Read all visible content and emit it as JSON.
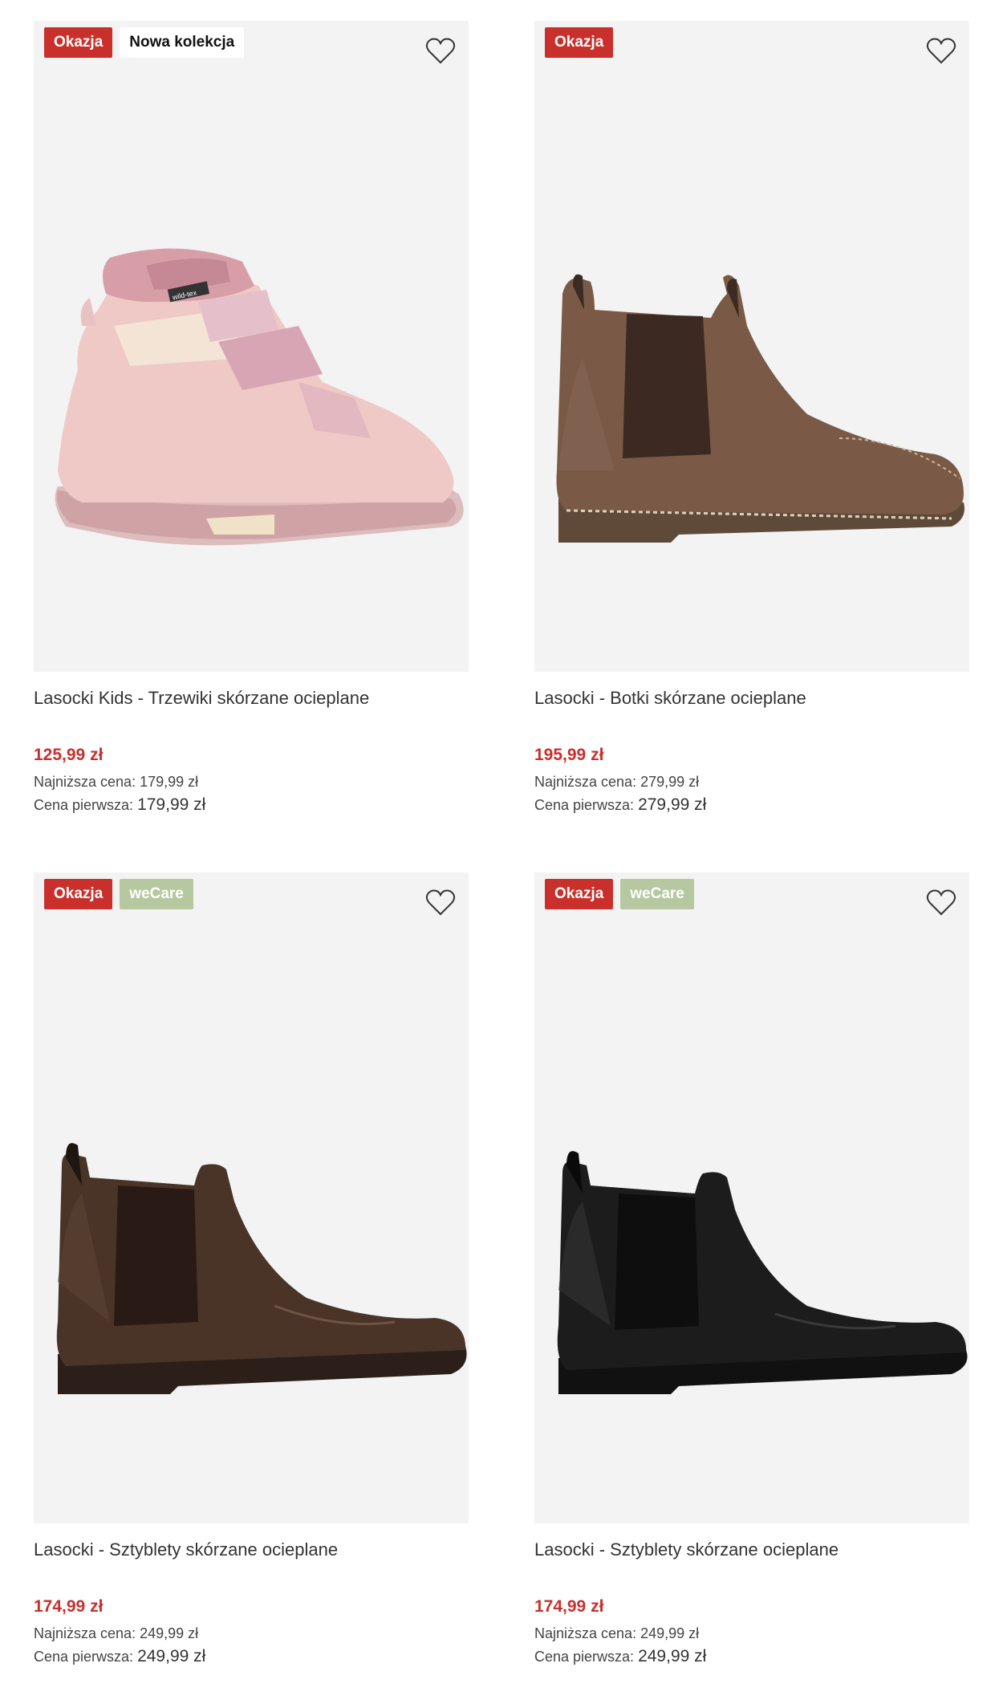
{
  "products": [
    {
      "badges": [
        "Okazja",
        "Nowa kolekcja"
      ],
      "title": "Lasocki Kids - Trzewiki skórzane ocieplane",
      "price": "125,99 zł",
      "lowest_label": "Najniższa cena:",
      "lowest_value": "179,99 zł",
      "first_label": "Cena pierwsza:",
      "first_value": "179,99 zł",
      "image": "pink-kids-velcro-boot",
      "brand_tag": "wild-tex"
    },
    {
      "badges": [
        "Okazja"
      ],
      "title": "Lasocki - Botki skórzane ocieplane",
      "price": "195,99 zł",
      "lowest_label": "Najniższa cena:",
      "lowest_value": "279,99 zł",
      "first_label": "Cena pierwsza:",
      "first_value": "279,99 zł",
      "image": "brown-nubuck-chelsea-boot"
    },
    {
      "badges": [
        "Okazja",
        "weCare"
      ],
      "title": "Lasocki - Sztyblety skórzane ocieplane",
      "price": "174,99 zł",
      "lowest_label": "Najniższa cena:",
      "lowest_value": "249,99 zł",
      "first_label": "Cena pierwsza:",
      "first_value": "249,99 zł",
      "image": "dark-brown-leather-chelsea-boot"
    },
    {
      "badges": [
        "Okazja",
        "weCare"
      ],
      "title": "Lasocki - Sztyblety skórzane ocieplane",
      "price": "174,99 zł",
      "lowest_label": "Najniższa cena:",
      "lowest_value": "249,99 zł",
      "first_label": "Cena pierwsza:",
      "first_value": "249,99 zł",
      "image": "black-leather-chelsea-boot"
    }
  ],
  "colors": {
    "okazja": "#c9302c",
    "wecare": "#b6c8a0",
    "price": "#c9302c",
    "image_bg": "#f3f3f3"
  },
  "icons": {
    "wishlist": "heart-outline-icon"
  }
}
